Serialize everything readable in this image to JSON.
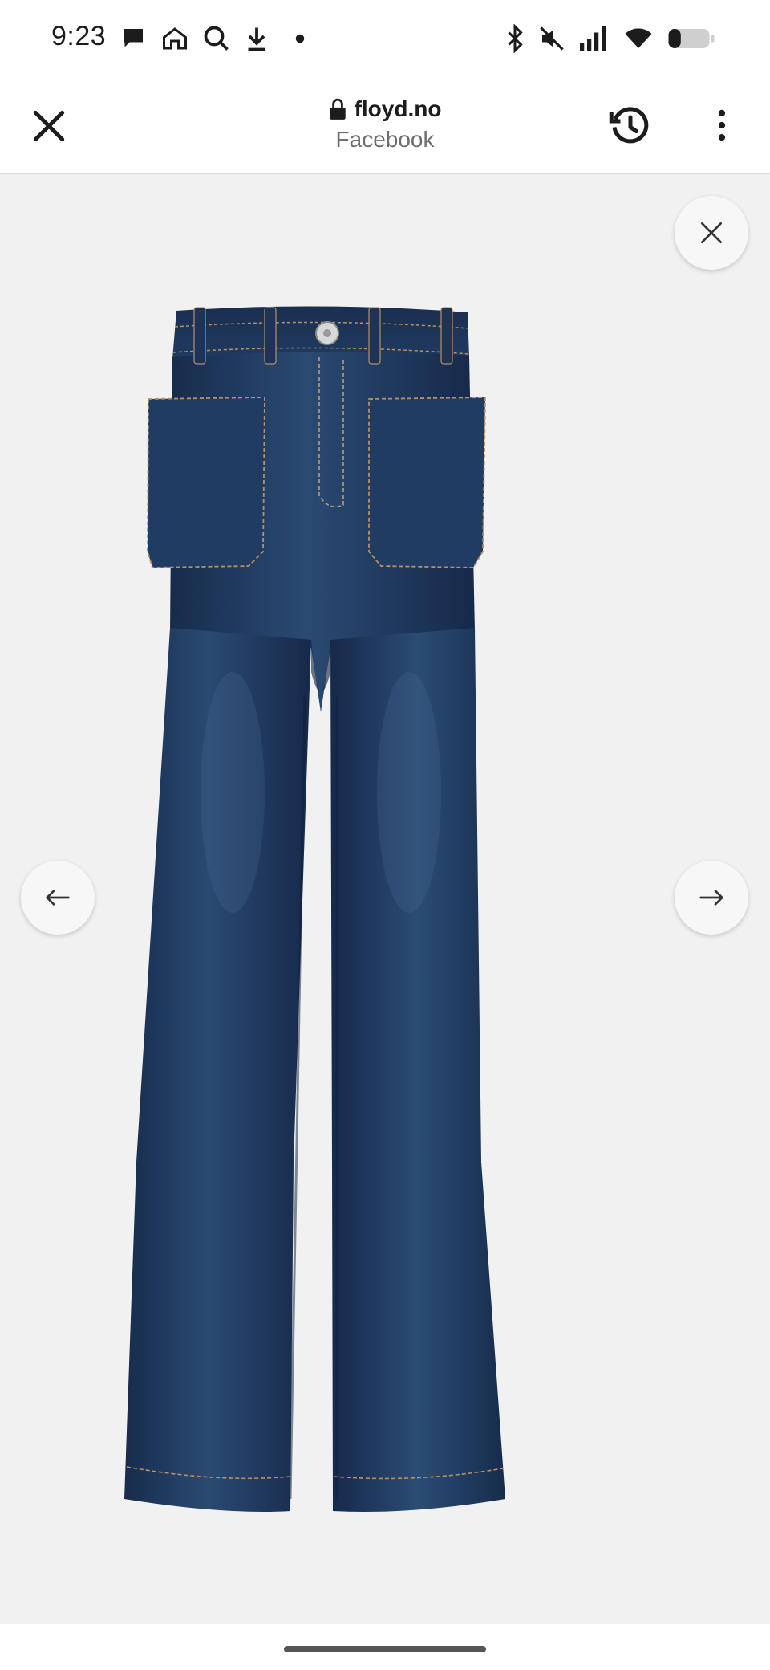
{
  "status_bar": {
    "time": "9:23",
    "left_icons": [
      "chat-bubble-icon",
      "home-icon",
      "search-icon",
      "download-icon",
      "dot-icon"
    ],
    "right_icons": [
      "bluetooth-icon",
      "mute-icon",
      "signal-icon",
      "wifi-icon",
      "battery-icon"
    ],
    "battery_level": 0.3
  },
  "browser": {
    "close_icon": "close-icon",
    "domain": "floyd.no",
    "source": "Facebook",
    "history_icon": "history-icon",
    "menu_icon": "more-vertical-icon"
  },
  "viewer": {
    "image_subject": "flared dark denim jeans",
    "close_button_icon": "close-icon",
    "prev_button_icon": "arrow-left-icon",
    "next_button_icon": "arrow-right-icon"
  },
  "colors": {
    "background": "#f1f1f1",
    "denim": "#1d3457",
    "denim_dark": "#14253f",
    "stitch": "#b8906a"
  }
}
